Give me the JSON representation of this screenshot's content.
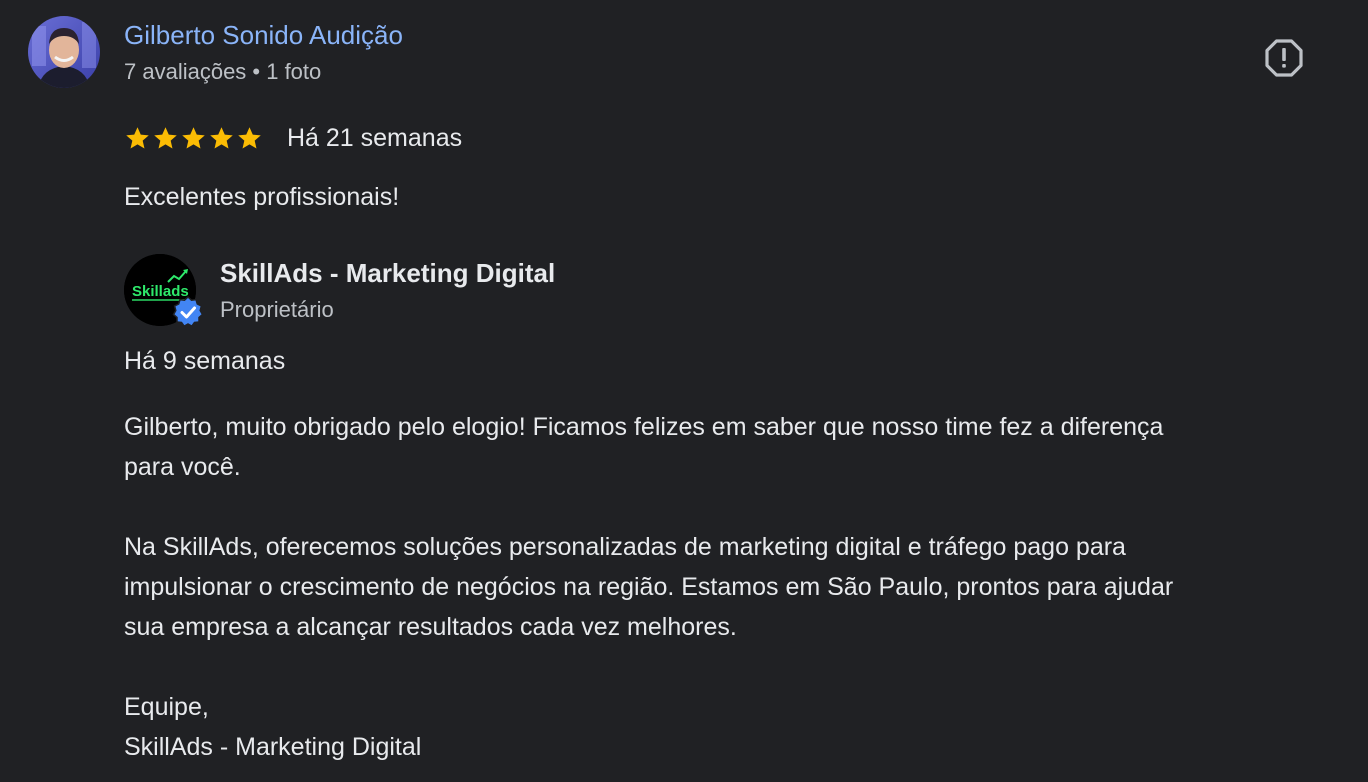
{
  "reviewer": {
    "name": "Gilberto Sonido Audição",
    "meta": "7 avaliações • 1 foto",
    "avatar_icon": "user-photo-avatar"
  },
  "review": {
    "stars": 5,
    "star_color": "#fbbc04",
    "date": "Há 21 semanas",
    "text": "Excelentes profissionais!"
  },
  "report_icon": "report-flag-icon",
  "owner_reply": {
    "name": "SkillAds - Marketing Digital",
    "role": "Proprietário",
    "logo_text": "Skillads",
    "logo_color": "#2ee86b",
    "badge_color": "#4285f4",
    "date": "Há 9 semanas",
    "paragraph_1_line_1": "Gilberto, muito obrigado pelo elogio! Ficamos felizes em saber que nosso time fez a diferença",
    "paragraph_1_line_2": "para você.",
    "paragraph_2_line_1": "Na SkillAds, oferecemos soluções personalizadas de marketing digital e tráfego pago para",
    "paragraph_2_line_2": "impulsionar o crescimento de negócios na região. Estamos em São Paulo, prontos para ajudar",
    "paragraph_2_line_3": "sua empresa a alcançar resultados cada vez melhores.",
    "signoff_line_1": "Equipe,",
    "signoff_line_2": "SkillAds - Marketing Digital"
  },
  "colors": {
    "background": "#202124",
    "link_blue": "#8ab4f8",
    "text_primary": "#e8eaed",
    "text_secondary": "#bdc1c6"
  }
}
